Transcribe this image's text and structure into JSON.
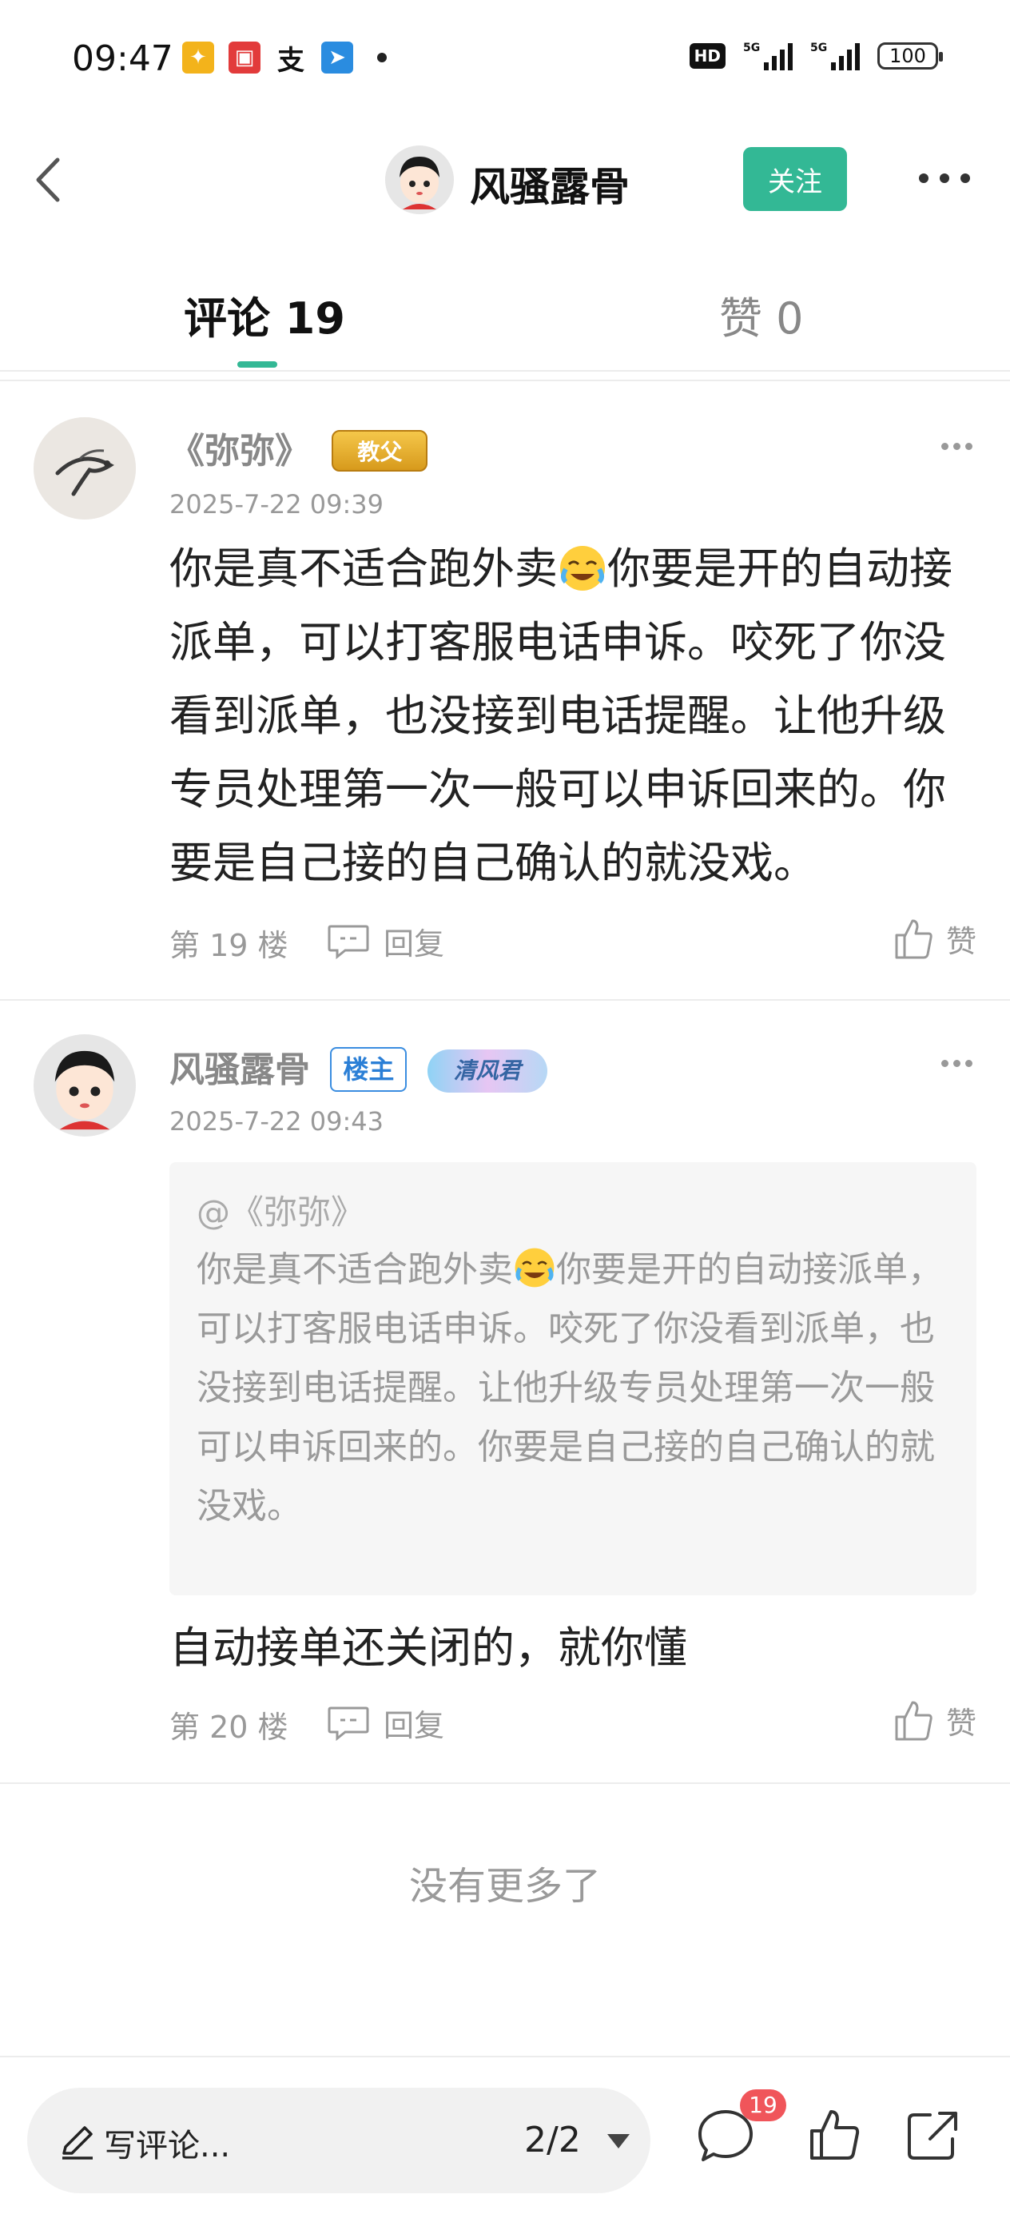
{
  "status_bar": {
    "time": "09:47",
    "network_1": "5G",
    "network_2": "5G",
    "hd_label": "HD",
    "battery": "100"
  },
  "header": {
    "username": "风骚露骨",
    "follow_label": "关注",
    "accent_color": "#33b895"
  },
  "tabs": {
    "comments_label": "评论 19",
    "likes_label": "赞 0"
  },
  "comments": [
    {
      "author": "《弥弥》",
      "badge": "教父",
      "time": "2025-7-22 09:39",
      "body_part1": "你是真不适合跑外卖",
      "body_part2": "你要是开的自动接派单，可以打客服电话申诉。咬死了你没看到派单，也没接到电话提醒。让他升级专员处理第一次一般可以申诉回来的。你要是自己接的自己确认的就没戏。",
      "floor": "第 19 楼",
      "reply_label": "回复",
      "like_label": "赞"
    },
    {
      "author": "风骚露骨",
      "owner_badge": "楼主",
      "fancy_badge": "清风君",
      "time": "2025-7-22 09:43",
      "quote_author": "@《弥弥》",
      "quote_part1": "你是真不适合跑外卖",
      "quote_part2": "你要是开的自动接派单，可以打客服电话申诉。咬死了你没看到派单，也没接到电话提醒。让他升级专员处理第一次一般可以申诉回来的。你要是自己接的自己确认的就没戏。",
      "body": "自动接单还关闭的，就你懂",
      "floor": "第 20 楼",
      "reply_label": "回复",
      "like_label": "赞"
    }
  ],
  "no_more_text": "没有更多了",
  "bottom_bar": {
    "composer_placeholder": "写评论...",
    "page_indicator": "2/2",
    "comment_count": "19"
  }
}
